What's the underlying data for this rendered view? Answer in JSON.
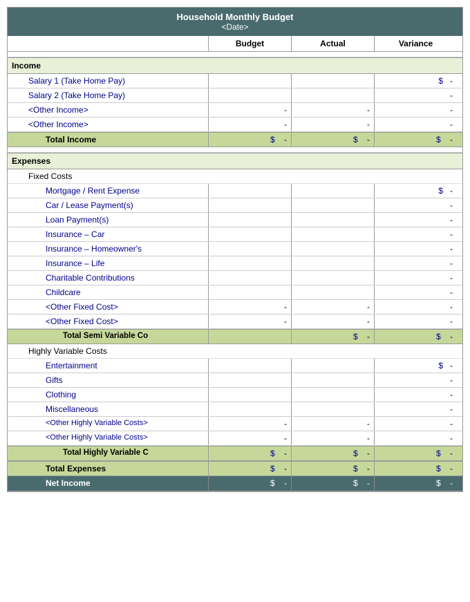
{
  "title": {
    "main": "Household Monthly Budget",
    "sub": "<Date>"
  },
  "headers": {
    "label": "",
    "budget": "Budget",
    "actual": "Actual",
    "variance": "Variance"
  },
  "sections": {
    "income": {
      "label": "Income",
      "rows": [
        {
          "label": "Salary 1 (Take Home Pay)",
          "indent": 1,
          "budget": "",
          "actual": "",
          "variance_dollar": "$",
          "variance": "-"
        },
        {
          "label": "Salary 2 (Take Home Pay)",
          "indent": 1,
          "budget": "",
          "actual": "",
          "variance_dollar": "",
          "variance": "-"
        },
        {
          "label": "<Other Income>",
          "indent": 1,
          "budget": "-",
          "actual": "-",
          "variance_dollar": "",
          "variance": "-"
        },
        {
          "label": "<Other Income>",
          "indent": 1,
          "budget": "-",
          "actual": "-",
          "variance_dollar": "",
          "variance": "-"
        }
      ],
      "total_label": "Total Income",
      "total_indent": 2
    },
    "expenses": {
      "label": "Expenses",
      "fixed": {
        "label": "Fixed Costs",
        "rows": [
          {
            "label": "Mortgage / Rent Expense",
            "budget": "",
            "actual": "",
            "variance_dollar": "$",
            "variance": "-"
          },
          {
            "label": "Car / Lease Payment(s)",
            "budget": "",
            "actual": "",
            "variance_dollar": "",
            "variance": "-"
          },
          {
            "label": "Loan Payment(s)",
            "budget": "",
            "actual": "",
            "variance_dollar": "",
            "variance": "-"
          },
          {
            "label": "Insurance – Car",
            "budget": "",
            "actual": "",
            "variance_dollar": "",
            "variance": "-"
          },
          {
            "label": "Insurance – Homeowner's",
            "budget": "",
            "actual": "",
            "variance_dollar": "",
            "variance": "-"
          },
          {
            "label": "Insurance – Life",
            "budget": "",
            "actual": "",
            "variance_dollar": "",
            "variance": "-"
          },
          {
            "label": "Charitable Contributions",
            "budget": "",
            "actual": "",
            "variance_dollar": "",
            "variance": "-"
          },
          {
            "label": "Childcare",
            "budget": "",
            "actual": "",
            "variance_dollar": "",
            "variance": "-"
          },
          {
            "label": "<Other Fixed Cost>",
            "budget": "-",
            "actual": "-",
            "variance_dollar": "",
            "variance": "-"
          },
          {
            "label": "<Other Fixed Cost>",
            "budget": "-",
            "actual": "-",
            "variance_dollar": "",
            "variance": "-"
          }
        ],
        "total_label": "Total Semi Variable Co",
        "total_budget_dollar": "",
        "total_actual_dollar": "$",
        "total_actual": "-",
        "total_variance_dollar": "$",
        "total_variance": "-"
      },
      "variable": {
        "label": "Highly Variable Costs",
        "rows": [
          {
            "label": "Entertainment",
            "budget": "",
            "actual": "",
            "variance_dollar": "$",
            "variance": "-"
          },
          {
            "label": "Gifts",
            "budget": "",
            "actual": "",
            "variance_dollar": "",
            "variance": "-"
          },
          {
            "label": "Clothing",
            "budget": "",
            "actual": "",
            "variance_dollar": "",
            "variance": "-"
          },
          {
            "label": "Miscellaneous",
            "budget": "",
            "actual": "",
            "variance_dollar": "",
            "variance": "-"
          },
          {
            "label": "<Other Highly Variable Costs>",
            "budget": "-",
            "actual": "-",
            "variance_dollar": "",
            "variance": "-"
          },
          {
            "label": "<Other Highly Variable Costs>",
            "budget": "-",
            "actual": "-",
            "variance_dollar": "",
            "variance": "-"
          }
        ],
        "total_label": "Total Highly Variable C",
        "total_expenses_label": "Total Expenses",
        "net_income_label": "Net Income"
      }
    }
  }
}
